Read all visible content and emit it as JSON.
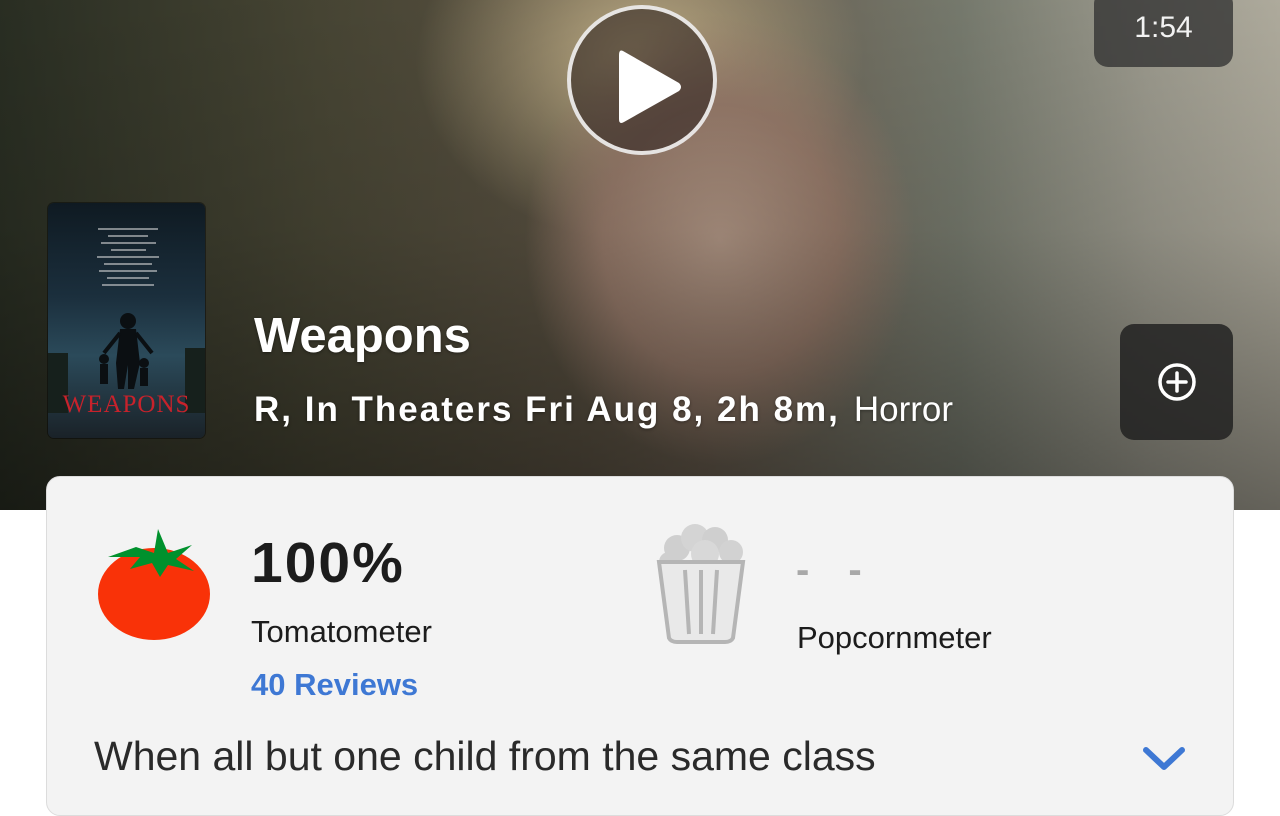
{
  "hero": {
    "duration": "1:54",
    "play_icon": "play-icon",
    "add_icon": "add-circle-icon"
  },
  "poster": {
    "title": "WEAPONS"
  },
  "movie": {
    "title": "Weapons",
    "info": "R, In Theaters Fri Aug 8, 2h 8m,",
    "genre": "Horror"
  },
  "scores": {
    "tomatometer": {
      "value": "100%",
      "label": "Tomatometer",
      "reviews": "40 Reviews",
      "icon": "tomato-icon",
      "color": "#f93208"
    },
    "popcornmeter": {
      "value": "- -",
      "label": "Popcornmeter",
      "icon": "popcorn-icon"
    }
  },
  "synopsis": {
    "text": "When all but one child from the same class",
    "expand_icon": "chevron-down-icon",
    "accent": "#3e78d4"
  }
}
